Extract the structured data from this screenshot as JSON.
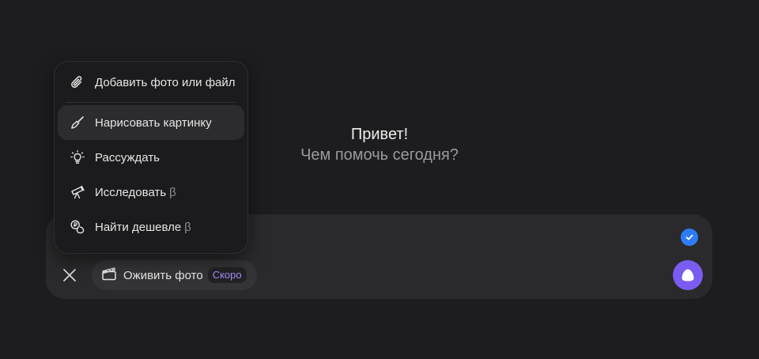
{
  "greeting": {
    "title": "Привет!",
    "subtitle": "Чем помочь сегодня?"
  },
  "menu": {
    "items": [
      {
        "label": "Добавить фото или файл",
        "icon": "paperclip-icon",
        "beta": ""
      },
      {
        "label": "Нарисовать картинку",
        "icon": "brush-icon",
        "beta": ""
      },
      {
        "label": "Рассуждать",
        "icon": "lightbulb-icon",
        "beta": ""
      },
      {
        "label": "Исследовать",
        "icon": "telescope-icon",
        "beta": "β"
      },
      {
        "label": "Найти дешевле",
        "icon": "coins-icon",
        "beta": "β"
      }
    ]
  },
  "composer": {
    "animate_label": "Оживить фото",
    "soon_badge": "Скоро"
  },
  "colors": {
    "background": "#1d1d1f",
    "accent_purple": "#7b5cf0",
    "check_blue": "#2f7bf5",
    "soon_text": "#a98cf7"
  }
}
